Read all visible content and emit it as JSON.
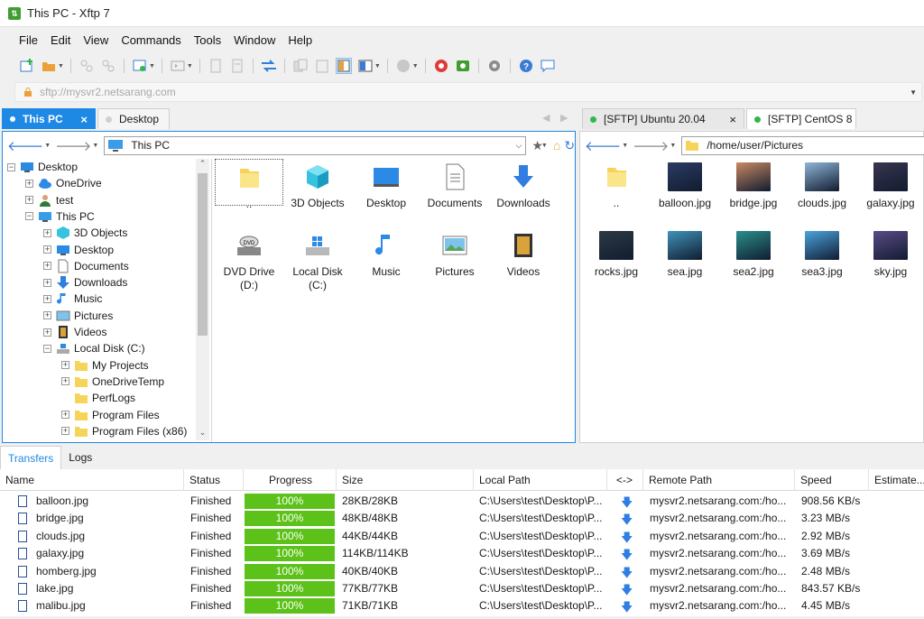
{
  "window": {
    "title": "This PC - Xftp 7"
  },
  "menu": [
    "File",
    "Edit",
    "View",
    "Commands",
    "Tools",
    "Window",
    "Help"
  ],
  "address": {
    "placeholder": "sftp://mysvr2.netsarang.com"
  },
  "left_tabs": [
    {
      "label": "This PC",
      "active": true
    },
    {
      "label": "Desktop",
      "active": false
    }
  ],
  "right_tabs": [
    {
      "label": "[SFTP] Ubuntu 20.04",
      "active": false
    },
    {
      "label": "[SFTP] CentOS 8",
      "active": true
    }
  ],
  "left_pane": {
    "path": "This PC",
    "tree": [
      {
        "label": "Desktop",
        "icon": "desktop-icon",
        "level": 0,
        "expander": "-"
      },
      {
        "label": "OneDrive",
        "icon": "cloud-icon",
        "level": 1,
        "expander": "+"
      },
      {
        "label": "test",
        "icon": "user-icon",
        "level": 1,
        "expander": "+"
      },
      {
        "label": "This PC",
        "icon": "monitor-icon",
        "level": 1,
        "expander": "-"
      },
      {
        "label": "3D Objects",
        "icon": "cube-icon",
        "level": 2,
        "expander": "+"
      },
      {
        "label": "Desktop",
        "icon": "desktop-icon",
        "level": 2,
        "expander": "+"
      },
      {
        "label": "Documents",
        "icon": "document-icon",
        "level": 2,
        "expander": "+"
      },
      {
        "label": "Downloads",
        "icon": "download-icon",
        "level": 2,
        "expander": "+"
      },
      {
        "label": "Music",
        "icon": "music-icon",
        "level": 2,
        "expander": "+"
      },
      {
        "label": "Pictures",
        "icon": "picture-icon",
        "level": 2,
        "expander": "+"
      },
      {
        "label": "Videos",
        "icon": "video-icon",
        "level": 2,
        "expander": "+"
      },
      {
        "label": "Local Disk (C:)",
        "icon": "disk-icon",
        "level": 2,
        "expander": "-"
      },
      {
        "label": "My Projects",
        "icon": "folder-icon",
        "level": 3,
        "expander": "+"
      },
      {
        "label": "OneDriveTemp",
        "icon": "folder-icon",
        "level": 3,
        "expander": "+"
      },
      {
        "label": "PerfLogs",
        "icon": "folder-icon",
        "level": 3,
        "expander": ""
      },
      {
        "label": "Program Files",
        "icon": "folder-icon",
        "level": 3,
        "expander": "+"
      },
      {
        "label": "Program Files (x86)",
        "icon": "folder-icon",
        "level": 3,
        "expander": "+"
      }
    ],
    "items": [
      {
        "label": "..",
        "icon": "folder-icon"
      },
      {
        "label": "3D Objects",
        "icon": "cube-icon"
      },
      {
        "label": "Desktop",
        "icon": "desktop-icon"
      },
      {
        "label": "Documents",
        "icon": "document-icon"
      },
      {
        "label": "Downloads",
        "icon": "download-icon"
      },
      {
        "label": "DVD Drive (D:)",
        "icon": "dvd-icon"
      },
      {
        "label": "Local Disk (C:)",
        "icon": "disk-icon"
      },
      {
        "label": "Music",
        "icon": "music-icon"
      },
      {
        "label": "Pictures",
        "icon": "picture-icon"
      },
      {
        "label": "Videos",
        "icon": "video-icon"
      }
    ]
  },
  "right_pane": {
    "path": "/home/user/Pictures",
    "items": [
      {
        "label": "..",
        "icon": "folder-icon",
        "color": "#f6d45a"
      },
      {
        "label": "balloon.jpg",
        "icon": "image-thumb",
        "color": "#2b3b63"
      },
      {
        "label": "bridge.jpg",
        "icon": "image-thumb",
        "color": "#c88a62"
      },
      {
        "label": "clouds.jpg",
        "icon": "image-thumb",
        "color": "#8fb6d8"
      },
      {
        "label": "galaxy.jpg",
        "icon": "image-thumb",
        "color": "#3a3550"
      },
      {
        "label": "rocks.jpg",
        "icon": "image-thumb",
        "color": "#2c3a44"
      },
      {
        "label": "sea.jpg",
        "icon": "image-thumb",
        "color": "#3f93b9"
      },
      {
        "label": "sea2.jpg",
        "icon": "image-thumb",
        "color": "#2a8f8c"
      },
      {
        "label": "sea3.jpg",
        "icon": "image-thumb",
        "color": "#4aa4df"
      },
      {
        "label": "sky.jpg",
        "icon": "image-thumb",
        "color": "#5a4a86"
      }
    ]
  },
  "bottom_tabs": [
    "Transfers",
    "Logs"
  ],
  "transfers": {
    "columns": [
      "Name",
      "Status",
      "Progress",
      "Size",
      "Local Path",
      "<->",
      "Remote Path",
      "Speed",
      "Estimate..."
    ],
    "rows": [
      {
        "name": "balloon.jpg",
        "status": "Finished",
        "progress": "100%",
        "size": "28KB/28KB",
        "local": "C:\\Users\\test\\Desktop\\P...",
        "remote": "mysvr2.netsarang.com:/ho...",
        "speed": "908.56 KB/s"
      },
      {
        "name": "bridge.jpg",
        "status": "Finished",
        "progress": "100%",
        "size": "48KB/48KB",
        "local": "C:\\Users\\test\\Desktop\\P...",
        "remote": "mysvr2.netsarang.com:/ho...",
        "speed": "3.23 MB/s"
      },
      {
        "name": "clouds.jpg",
        "status": "Finished",
        "progress": "100%",
        "size": "44KB/44KB",
        "local": "C:\\Users\\test\\Desktop\\P...",
        "remote": "mysvr2.netsarang.com:/ho...",
        "speed": "2.92 MB/s"
      },
      {
        "name": "galaxy.jpg",
        "status": "Finished",
        "progress": "100%",
        "size": "114KB/114KB",
        "local": "C:\\Users\\test\\Desktop\\P...",
        "remote": "mysvr2.netsarang.com:/ho...",
        "speed": "3.69 MB/s"
      },
      {
        "name": "homberg.jpg",
        "status": "Finished",
        "progress": "100%",
        "size": "40KB/40KB",
        "local": "C:\\Users\\test\\Desktop\\P...",
        "remote": "mysvr2.netsarang.com:/ho...",
        "speed": "2.48 MB/s"
      },
      {
        "name": "lake.jpg",
        "status": "Finished",
        "progress": "100%",
        "size": "77KB/77KB",
        "local": "C:\\Users\\test\\Desktop\\P...",
        "remote": "mysvr2.netsarang.com:/ho...",
        "speed": "843.57 KB/s"
      },
      {
        "name": "malibu.jpg",
        "status": "Finished",
        "progress": "100%",
        "size": "71KB/71KB",
        "local": "C:\\Users\\test\\Desktop\\P...",
        "remote": "mysvr2.netsarang.com:/ho...",
        "speed": "4.45 MB/s"
      }
    ]
  },
  "colors": {
    "accent": "#1e88e5",
    "progress": "#5cc219",
    "folder": "#f6d45a",
    "connected": "#2db84d"
  }
}
